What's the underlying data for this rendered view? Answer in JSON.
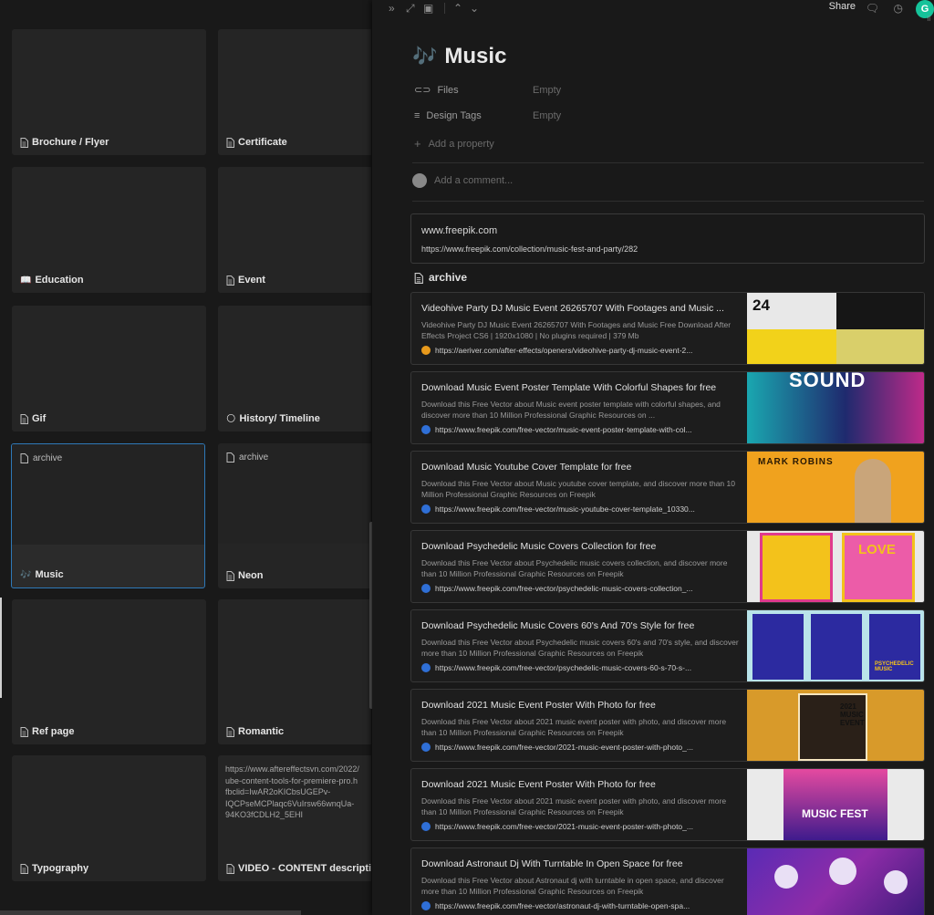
{
  "gallery": {
    "cards": [
      {
        "label": "Brochure / Flyer",
        "icon": "doc-icon"
      },
      {
        "label": "Certificate",
        "icon": "doc-icon"
      },
      {
        "label": "Education",
        "icon": "book-icon",
        "emoji": "📖"
      },
      {
        "label": "Event",
        "icon": "doc-icon"
      },
      {
        "label": "Gif",
        "icon": "doc-icon"
      },
      {
        "label": "History/ Timeline",
        "icon": "moon-icon",
        "emoji": "🌕"
      },
      {
        "label": "Music",
        "icon": "music-icon",
        "emoji": "🎶",
        "inner": "archive"
      },
      {
        "label": "Neon",
        "icon": "doc-icon",
        "inner": "archive"
      },
      {
        "label": "Ref page",
        "icon": "doc-icon"
      },
      {
        "label": "Romantic",
        "icon": "doc-icon"
      },
      {
        "label": "Typography",
        "icon": "doc-icon"
      },
      {
        "label": "VIDEO - CONTENT descriptio",
        "icon": "doc-icon",
        "url_text": "https://www.aftereffectsvn.com/2022/\nube-content-tools-for-premiere-pro.h\nfbclid=IwAR2oKICbsUGEPv-\nIQCPseMCPlaqc6VuIrsw66wnqUa-\n94KO3fCDLH2_5EHI"
      }
    ]
  },
  "panel": {
    "toolbar": {
      "share": "Share"
    },
    "title": "Music",
    "title_emoji": "🎶",
    "properties": [
      {
        "name": "Files",
        "value": "Empty"
      },
      {
        "name": "Design Tags",
        "value": "Empty"
      }
    ],
    "add_property": "Add a property",
    "comment_placeholder": "Add a comment...",
    "link": {
      "site": "www.freepik.com",
      "url": "https://www.freepik.com/collection/music-fest-and-party/282"
    },
    "archive_heading": "archive",
    "bookmarks": [
      {
        "title": "Videohive Party DJ Music Event 26265707 With Footages and Music ...",
        "desc": "Videohive Party DJ Music Event 26265707 With Footages and Music Free Download After Effects Project CS6 | 1920x1080 | No plugins required | 379 Mb",
        "url": "https://aeriver.com/after-effects/openers/videohive-party-dj-music-event-2...",
        "fav_color": "#e89a1c",
        "thumb_text": "24"
      },
      {
        "title": "Download Music Event Poster Template With Colorful Shapes for free",
        "desc": "Download this Free Vector about Music event poster template with colorful shapes, and discover more than 10 Million Professional Graphic Resources on ...",
        "url": "https://www.freepik.com/free-vector/music-event-poster-template-with-col...",
        "fav_color": "#2f6fd6",
        "thumb_text": "SOUND"
      },
      {
        "title": "Download Music Youtube Cover Template for free",
        "desc": "Download this Free Vector about Music youtube cover template, and discover more than 10 Million Professional Graphic Resources on Freepik",
        "url": "https://www.freepik.com/free-vector/music-youtube-cover-template_10330...",
        "fav_color": "#2f6fd6",
        "thumb_text": "MARK ROBINS"
      },
      {
        "title": "Download Psychedelic Music Covers Collection for free",
        "desc": "Download this Free Vector about Psychedelic music covers collection, and discover more than 10 Million Professional Graphic Resources on Freepik",
        "url": "https://www.freepik.com/free-vector/psychedelic-music-covers-collection_...",
        "fav_color": "#2f6fd6",
        "thumb_text": "LOVE"
      },
      {
        "title": "Download Psychedelic Music Covers 60's And 70's Style for free",
        "desc": "Download this Free Vector about Psychedelic music covers 60's and 70's style, and discover more than 10 Million Professional Graphic Resources on Freepik",
        "url": "https://www.freepik.com/free-vector/psychedelic-music-covers-60-s-70-s-...",
        "fav_color": "#2f6fd6",
        "thumb_text": "PSYCHEDELIC MUSIC"
      },
      {
        "title": "Download 2021 Music Event Poster With Photo for free",
        "desc": "Download this Free Vector about 2021 music event poster with photo, and discover more than 10 Million Professional Graphic Resources on Freepik",
        "url": "https://www.freepik.com/free-vector/2021-music-event-poster-with-photo_...",
        "fav_color": "#2f6fd6",
        "thumb_text": "2021 MUSIC EVENT"
      },
      {
        "title": "Download 2021 Music Event Poster With Photo for free",
        "desc": "Download this Free Vector about 2021 music event poster with photo, and discover more than 10 Million Professional Graphic Resources on Freepik",
        "url": "https://www.freepik.com/free-vector/2021-music-event-poster-with-photo_...",
        "fav_color": "#2f6fd6",
        "thumb_text": "MUSIC FEST"
      },
      {
        "title": "Download Astronaut Dj With Turntable In Open Space for free",
        "desc": "Download this Free Vector about Astronaut dj with turntable in open space, and discover more than 10 Million Professional Graphic Resources on Freepik",
        "url": "https://www.freepik.com/free-vector/astronaut-dj-with-turntable-open-spa...",
        "fav_color": "#2f6fd6",
        "thumb_text": ""
      }
    ]
  },
  "colors": {
    "background": "#191919",
    "card": "#252525",
    "selection": "#2e79b8",
    "grammarly": "#15c39a"
  }
}
